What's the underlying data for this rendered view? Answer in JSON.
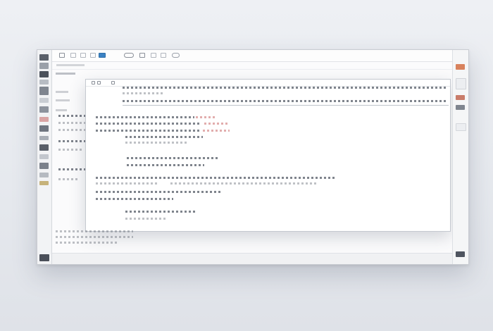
{
  "window": {
    "title": "",
    "accent": "#3b82c4"
  },
  "toolbar": {
    "icons": [
      "grid-icon",
      "text-icon",
      "image-icon",
      "table-icon",
      "link-icon",
      "shape-icon",
      "comment-icon",
      "chart-icon",
      "cloud-icon"
    ]
  },
  "panel": {
    "heading": "",
    "rows": 9
  },
  "right_rail": {
    "icons": [
      "share-icon",
      "note-icon",
      "image-icon",
      "settings-icon",
      "doc-icon"
    ]
  },
  "colors": {
    "text": "#5f6570",
    "highlight": "#d58a8a",
    "border": "#c5c9d0"
  }
}
